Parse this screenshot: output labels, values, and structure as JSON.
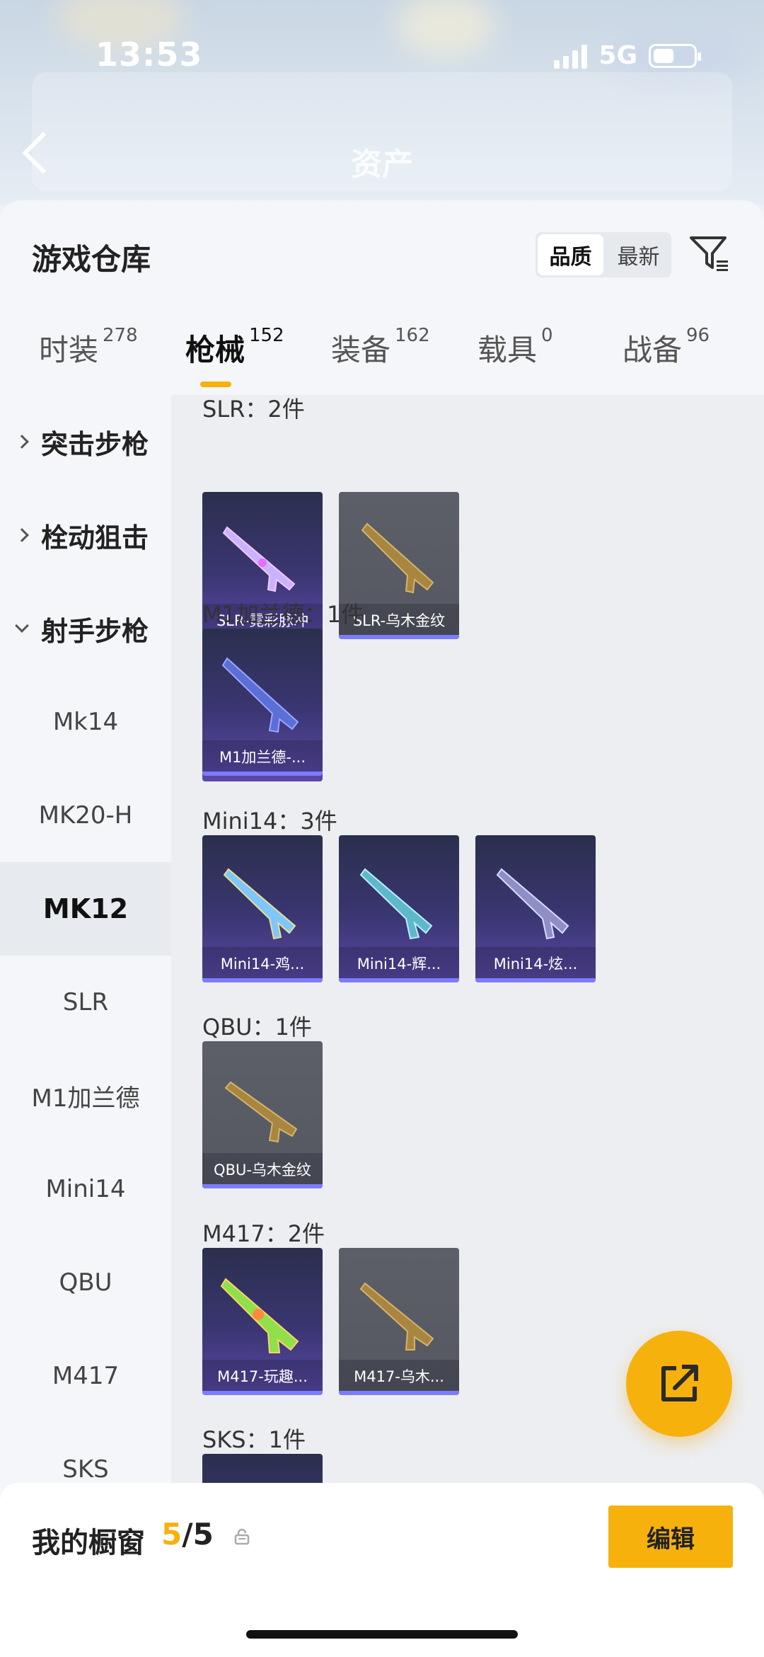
{
  "status": {
    "time": "13:53",
    "network": "5G"
  },
  "header": {
    "title": "资产"
  },
  "sheet": {
    "title": "游戏仓库",
    "sort": {
      "options": [
        "品质",
        "最新"
      ],
      "selected": "品质"
    }
  },
  "tabs": [
    {
      "label": "时装",
      "count": "278"
    },
    {
      "label": "枪械",
      "count": "152",
      "active": true
    },
    {
      "label": "装备",
      "count": "162"
    },
    {
      "label": "载具",
      "count": "0"
    },
    {
      "label": "战备",
      "count": "96"
    }
  ],
  "categories": [
    {
      "label": "突击步枪",
      "expanded": false
    },
    {
      "label": "栓动狙击",
      "expanded": false
    },
    {
      "label": "射手步枪",
      "expanded": true
    }
  ],
  "subcategories": [
    "Mk14",
    "MK20-H",
    "MK12",
    "SLR",
    "M1加兰德",
    "Mini14",
    "QBU",
    "M417",
    "SKS"
  ],
  "selected_subcategory": "MK12",
  "groups": [
    {
      "title": "SLR：2件",
      "items": [
        {
          "name": "SLR-霓彩脉冲",
          "tier": "purple"
        },
        {
          "name": "SLR-乌木金纹",
          "tier": "grey"
        }
      ]
    },
    {
      "title": "M1加兰德：1件",
      "items": [
        {
          "name": "M1加兰德-...",
          "tier": "purple"
        }
      ]
    },
    {
      "title": "Mini14：3件",
      "items": [
        {
          "name": "Mini14-鸡...",
          "tier": "purple"
        },
        {
          "name": "Mini14-辉...",
          "tier": "purple"
        },
        {
          "name": "Mini14-炫...",
          "tier": "purple"
        }
      ]
    },
    {
      "title": "QBU：1件",
      "items": [
        {
          "name": "QBU-乌木金纹",
          "tier": "grey"
        }
      ]
    },
    {
      "title": "M417：2件",
      "items": [
        {
          "name": "M417-玩趣...",
          "tier": "purple"
        },
        {
          "name": "M417-乌木...",
          "tier": "grey"
        }
      ]
    },
    {
      "title": "SKS：1件",
      "items": [
        {
          "name": "",
          "tier": "purple"
        }
      ]
    }
  ],
  "showcase": {
    "label": "我的橱窗",
    "current": "5",
    "total": "/5",
    "edit_label": "编辑"
  },
  "colors": {
    "accent": "#f6b10d",
    "purple_tier": "#5a49a7",
    "grey_tier": "#555861",
    "tier_bar": "#7c7cff"
  }
}
